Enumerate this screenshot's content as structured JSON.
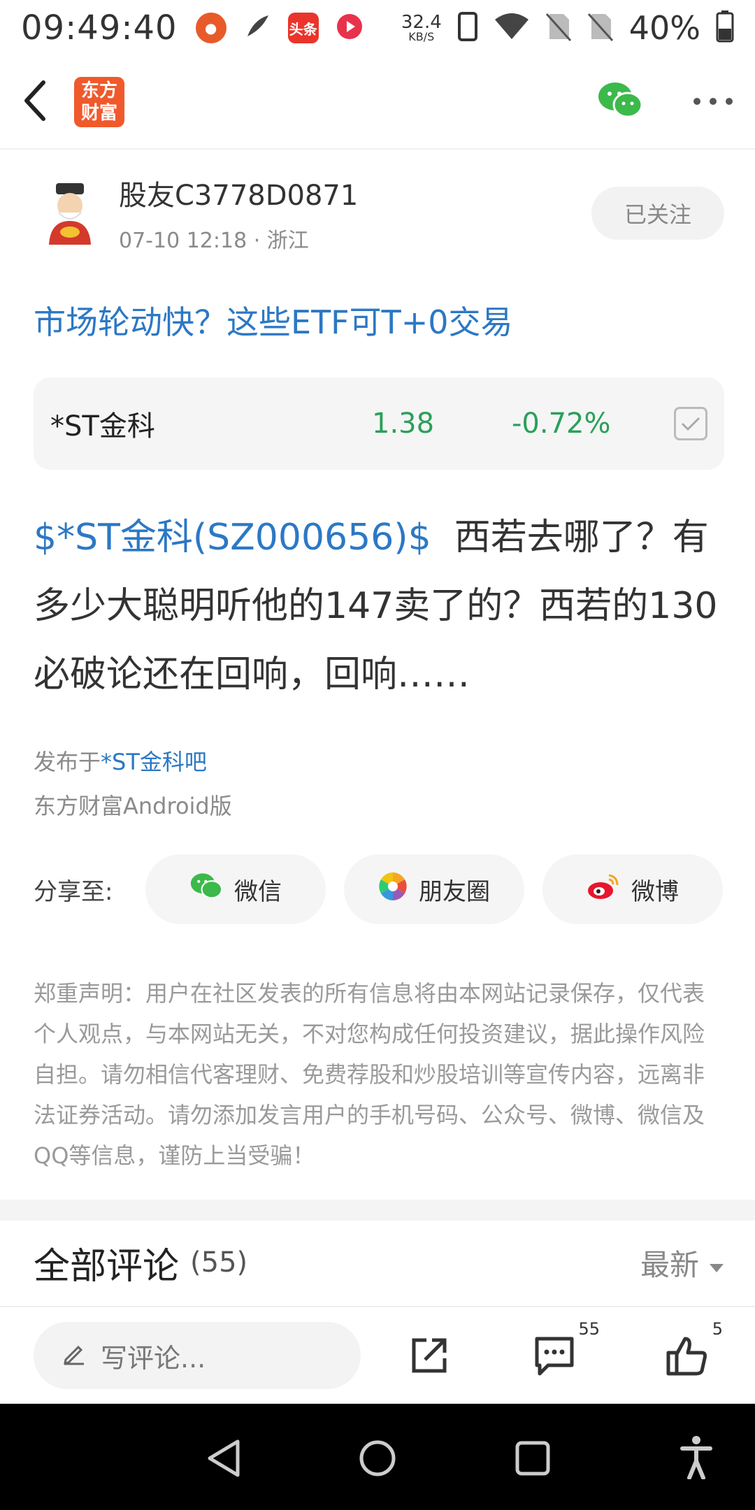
{
  "status_bar": {
    "time": "09:49:40",
    "net_speed_value": "32.4",
    "net_speed_unit": "KB/S",
    "battery": "40%",
    "app_icons": [
      "app-icon-1",
      "feather-icon",
      "toutiao-icon",
      "video-icon"
    ],
    "toutiao_label": "头条"
  },
  "nav": {
    "logo_top": "东方",
    "logo_bottom": "财富"
  },
  "author": {
    "name": "股友C3778D0871",
    "meta": "07-10 12:18 · 浙江",
    "follow_label": "已关注"
  },
  "ad_link": "市场轮动快？这些ETF可T+0交易",
  "stock": {
    "name": "*ST金科",
    "price": "1.38",
    "change": "-0.72%"
  },
  "post": {
    "stock_tag": "$*ST金科(SZ000656)$",
    "text": "西若去哪了？有多少大聪明听他的147卖了的？西若的130必破论还在回响，回响……"
  },
  "published": {
    "prefix": "发布于",
    "bar": "*ST金科吧",
    "client": "东方财富Android版"
  },
  "share": {
    "label": "分享至:",
    "wechat": "微信",
    "moments": "朋友圈",
    "weibo": "微博"
  },
  "disclaimer": "郑重声明：用户在社区发表的所有信息将由本网站记录保存，仅代表个人观点，与本网站无关，不对您构成任何投资建议，据此操作风险自担。请勿相信代客理财、免费荐股和炒股培训等宣传内容，远离非法证券活动。请勿添加发言用户的手机号码、公众号、微博、微信及QQ等信息，谨防上当受骗！",
  "comments": {
    "title": "全部评论",
    "count": "(55)",
    "sort": "最新"
  },
  "bottom_bar": {
    "write_placeholder": "写评论...",
    "comment_count": "55",
    "like_count": "5"
  },
  "colors": {
    "link_blue": "#2c78c4",
    "stock_green": "#2aa05a",
    "brand_orange": "#f0592b"
  }
}
